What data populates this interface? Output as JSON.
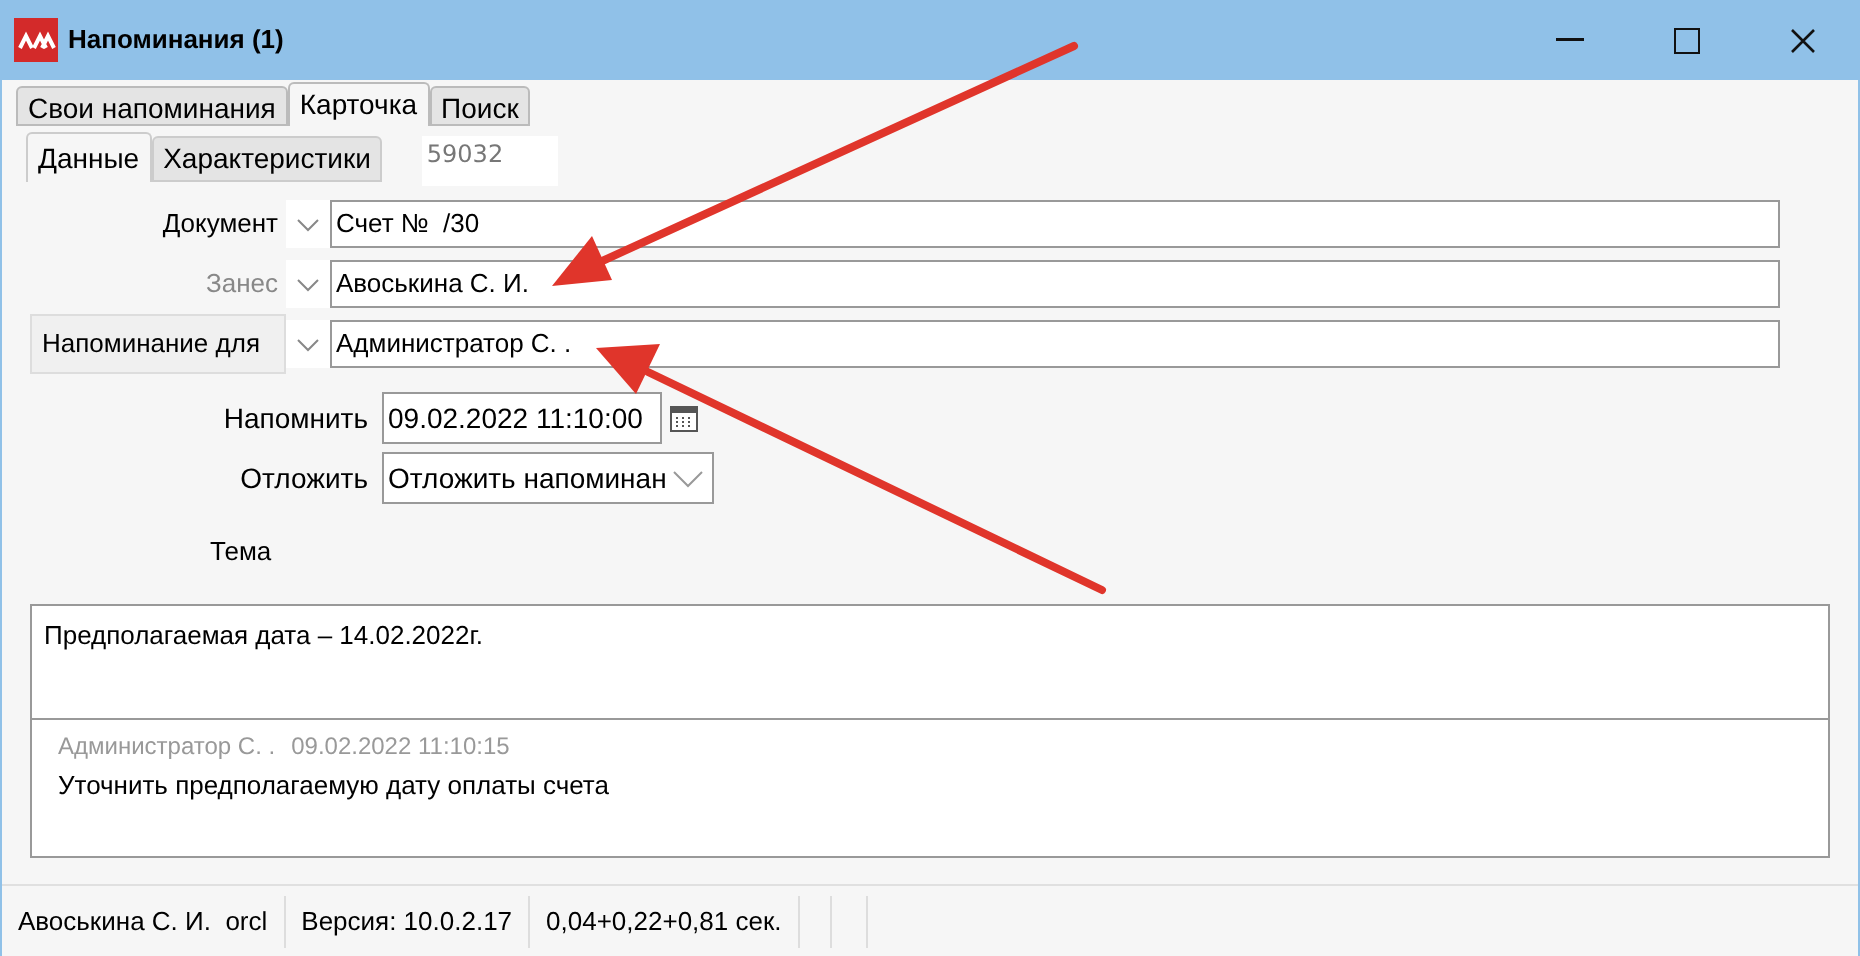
{
  "window": {
    "title": "Напоминания (1)"
  },
  "tabs": [
    {
      "label": "Свои напоминания",
      "selected": false
    },
    {
      "label": "Карточка",
      "selected": true
    },
    {
      "label": "Поиск",
      "selected": false
    }
  ],
  "subtabs": [
    {
      "label": "Данные",
      "selected": true
    },
    {
      "label": "Характеристики",
      "selected": false
    }
  ],
  "record_id": "59032",
  "fields": [
    {
      "label": "Документ",
      "kind": "label",
      "value": "Счет №  /30"
    },
    {
      "label": "Занес",
      "kind": "label",
      "disabled": true,
      "value": "Авоськина С. И."
    },
    {
      "label": "Напоминание для",
      "kind": "button",
      "value": "Администратор С. ."
    }
  ],
  "remind": {
    "label": "Напомнить",
    "value": "09.02.2022 11:10:00"
  },
  "postpone": {
    "label": "Отложить",
    "value": "Отложить напоминан"
  },
  "subject": {
    "label": "Тема"
  },
  "note": {
    "text": "Предполагаемая дата – 14.02.2022г."
  },
  "comment": {
    "author": "Администратор С. .",
    "time": "09.02.2022 11:10:15",
    "text": "Уточнить предполагаемую дату оплаты счета"
  },
  "status_bar": [
    "Авоськина С. И.  orcl",
    "Версия: 10.0.2.17",
    "0,04+0,22+0,81 сек."
  ]
}
